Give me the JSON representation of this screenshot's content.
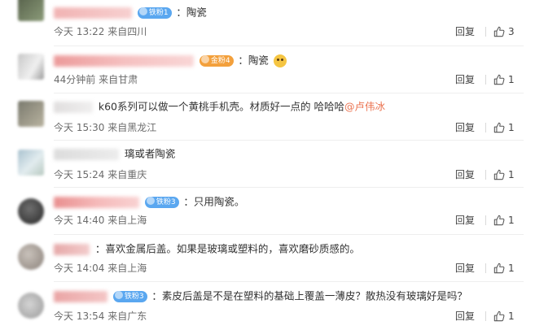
{
  "comments": [
    {
      "badge": "铁粉1",
      "badge_color": "#5aa7f0",
      "text": "：陶瓷",
      "time": "今天 13:22",
      "location": "来自四川",
      "reply": "回复",
      "likes": "3"
    },
    {
      "badge": "金粉4",
      "badge_color": "#f3a03c",
      "text": "：陶瓷",
      "emoji": "doge-emoji",
      "time": "44分钟前",
      "location": "来自甘肃",
      "reply": "回复",
      "likes": "1"
    },
    {
      "text": "k60系列可以做一个黄桃手机壳。材质好一点的 哈哈哈",
      "mention": "@卢伟冰",
      "time": "今天 15:30",
      "location": "来自黑龙江",
      "reply": "回复",
      "likes": "1"
    },
    {
      "text": "璃或者陶瓷",
      "time": "今天 15:24",
      "location": "来自重庆",
      "reply": "回复",
      "likes": "1"
    },
    {
      "badge": "铁粉3",
      "badge_color": "#5aa7f0",
      "text": "：只用陶瓷。",
      "time": "今天 14:40",
      "location": "来自上海",
      "reply": "回复",
      "likes": "1"
    },
    {
      "text": "：喜欢金属后盖。如果是玻璃或塑料的，喜欢磨砂质感的。",
      "time": "今天 14:04",
      "location": "来自上海",
      "reply": "回复",
      "likes": "1"
    },
    {
      "badge": "铁粉3",
      "badge_color": "#5aa7f0",
      "text": "：素皮后盖是不是在塑料的基础上覆盖一薄皮？散热没有玻璃好是吗？",
      "time": "今天 13:54",
      "location": "来自广东",
      "reply": "回复",
      "likes": "1"
    }
  ]
}
